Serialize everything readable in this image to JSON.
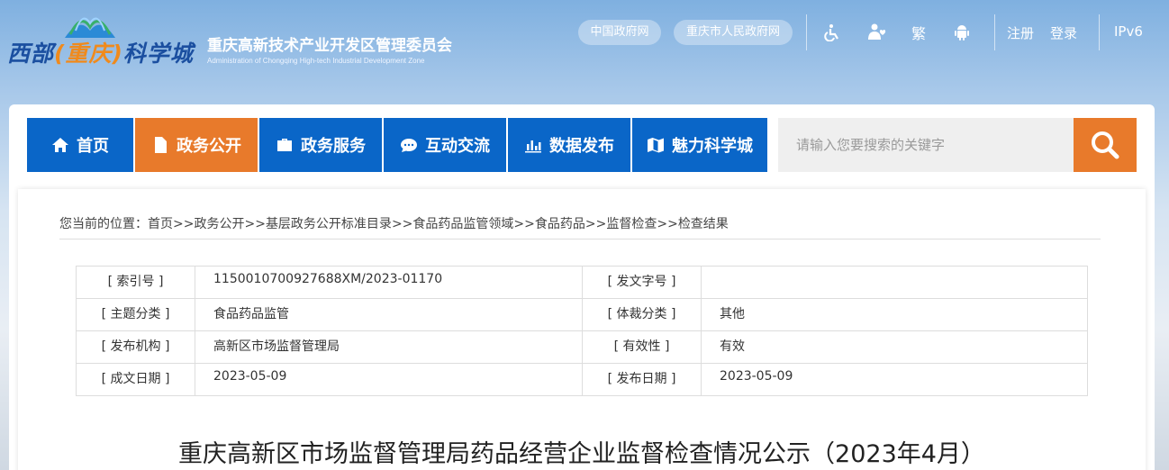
{
  "header": {
    "logo_parts": [
      "西部",
      "(重庆)",
      "科学城"
    ],
    "org_name_cn": "重庆高新技术产业开发区管理委员会",
    "org_name_en": "Administration of Chongqing High-tech Industrial Development Zone",
    "links": [
      "中国政府网",
      "重庆市人民政府网"
    ],
    "icons": [
      "accessibility-icon",
      "elder-care-icon",
      "traditional-chinese-icon",
      "android-icon"
    ],
    "traditional_label": "繁",
    "register": "注册",
    "login": "登录",
    "ipv6": "IPv6"
  },
  "nav": {
    "items": [
      {
        "label": "首页",
        "icon": "home-icon"
      },
      {
        "label": "政务公开",
        "icon": "document-icon",
        "active": true
      },
      {
        "label": "政务服务",
        "icon": "briefcase-icon"
      },
      {
        "label": "互动交流",
        "icon": "chat-icon"
      },
      {
        "label": "数据发布",
        "icon": "bar-chart-icon"
      },
      {
        "label": "魅力科学城",
        "icon": "map-icon"
      }
    ],
    "search_placeholder": "请输入您要搜索的关键字"
  },
  "breadcrumb": {
    "prefix": "您当前的位置：",
    "items": [
      "首页",
      "政务公开",
      "基层政务公开标准目录",
      "食品药品监管领域",
      "食品药品",
      "监督检查",
      "检查结果"
    ],
    "separator": ">>"
  },
  "meta": {
    "rows": [
      {
        "k1": "[ 索引号 ]",
        "v1": "1150010700927688XM/2023-01170",
        "k2": "[ 发文字号 ]",
        "v2": ""
      },
      {
        "k1": "[ 主题分类 ]",
        "v1": "食品药品监管",
        "k2": "[ 体裁分类 ]",
        "v2": "其他"
      },
      {
        "k1": "[ 发布机构 ]",
        "v1": "高新区市场监督管理局",
        "k2": "[ 有效性 ]",
        "v2": "有效"
      },
      {
        "k1": "[ 成文日期 ]",
        "v1": "2023-05-09",
        "k2": "[ 发布日期 ]",
        "v2": "2023-05-09"
      }
    ]
  },
  "article": {
    "title": "重庆高新区市场监督管理局药品经营企业监督检查情况公示（2023年4月）"
  },
  "colors": {
    "nav_blue": "#0a66c8",
    "accent_orange": "#e87a2b"
  }
}
